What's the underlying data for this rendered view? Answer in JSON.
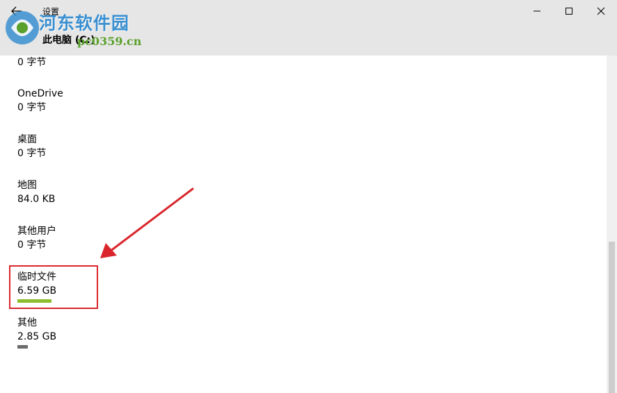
{
  "window": {
    "app_title": "设置",
    "page_title": "此电脑 (C:)"
  },
  "watermark": {
    "brand": "河东软件园",
    "url": "pc0359.cn"
  },
  "items": [
    {
      "name": "",
      "size": "0 字节"
    },
    {
      "name": "OneDrive",
      "size": "0 字节"
    },
    {
      "name": "桌面",
      "size": "0 字节"
    },
    {
      "name": "地图",
      "size": "84.0 KB"
    },
    {
      "name": "其他用户",
      "size": "0 字节"
    },
    {
      "name": "临时文件",
      "size": "6.59 GB",
      "bar_color": "#8cbd2e",
      "bar_fraction": 0.35
    },
    {
      "name": "其他",
      "size": "2.85 GB",
      "bar_color": "#6b6b6b",
      "bar_fraction": 0.11
    }
  ],
  "colors": {
    "accent_green": "#8cbd2e",
    "annotation_red": "#d9252b",
    "titlebar": "#e6e6e6"
  },
  "icons": [
    "back-arrow-icon",
    "minimize-icon",
    "maximize-icon",
    "close-icon"
  ]
}
